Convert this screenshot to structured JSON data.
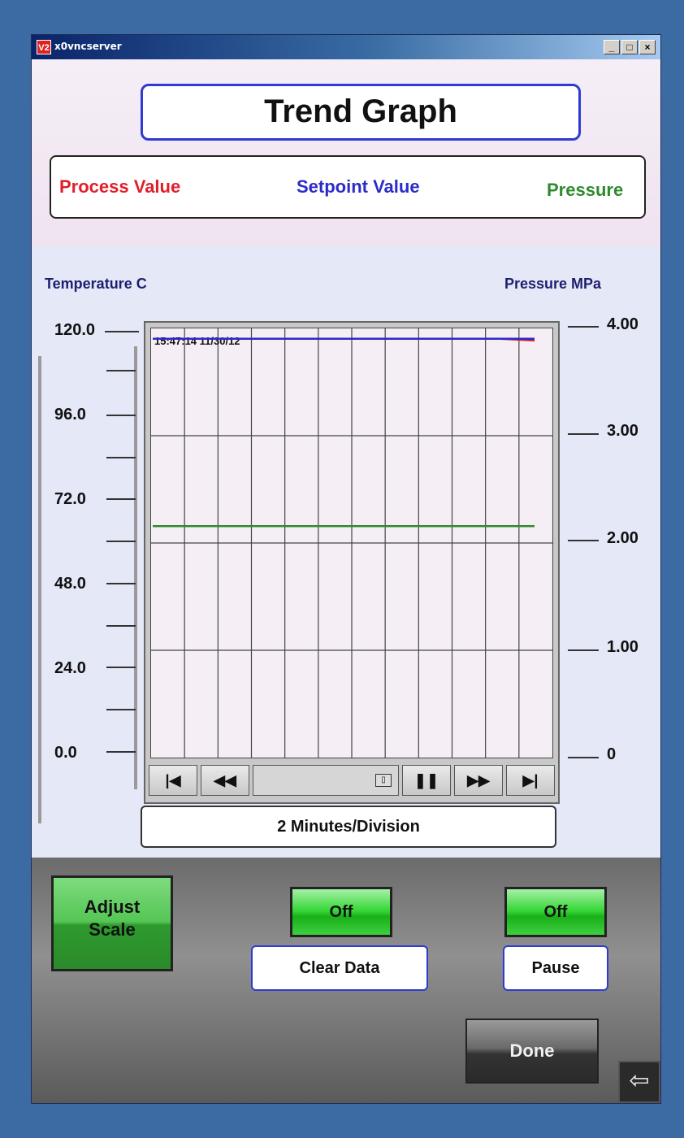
{
  "window": {
    "app_icon": "V2",
    "title": "x0vncserver",
    "controls": [
      "_",
      "□",
      "×"
    ]
  },
  "header": {
    "title": "Trend Graph"
  },
  "legend": {
    "process": "Process Value",
    "setpoint": "Setpoint Value",
    "pressure": "Pressure"
  },
  "axes": {
    "left_title": "Temperature  C",
    "right_title": "Pressure  MPa",
    "left_ticks": [
      "120.0",
      "96.0",
      "72.0",
      "48.0",
      "24.0",
      "0.0"
    ],
    "right_ticks": [
      "4.00",
      "3.00",
      "2.00",
      "1.00",
      "0"
    ]
  },
  "plot": {
    "timestamp": "15:47:14  11/30/12"
  },
  "nav": {
    "first_icon": "first-page-icon",
    "rewind_icon": "rewind-icon",
    "pause_icon": "pause-icon",
    "forward_icon": "fast-forward-icon",
    "last_icon": "last-page-icon"
  },
  "division": "2 Minutes/Division",
  "controls": {
    "adjust_line1": "Adjust",
    "adjust_line2": "Scale",
    "clear_state": "Off",
    "clear_label": "Clear Data",
    "pause_state": "Off",
    "pause_label": "Pause",
    "done": "Done",
    "back_icon": "back-arrow-icon"
  },
  "chart_data": {
    "type": "line",
    "title": "Trend Graph",
    "ylabel": "Temperature  C",
    "y2label": "Pressure  MPa",
    "ylim": [
      0,
      120
    ],
    "y2lim": [
      0,
      4
    ],
    "yticks": [
      0,
      24,
      48,
      72,
      96,
      120
    ],
    "y2ticks": [
      0,
      1,
      2,
      3,
      4
    ],
    "x_divisions": 12,
    "x_unit": "2 Minutes/Division",
    "series": [
      {
        "name": "Process Value",
        "axis": "left",
        "color": "#e01f2a",
        "values": [
          117,
          117,
          117,
          117,
          117,
          117,
          117,
          117,
          117,
          117,
          117,
          116.5
        ]
      },
      {
        "name": "Setpoint Value",
        "axis": "left",
        "color": "#2b2bc8",
        "values": [
          117,
          117,
          117,
          117,
          117,
          117,
          117,
          117,
          117,
          117,
          117,
          117
        ]
      },
      {
        "name": "Pressure",
        "axis": "right",
        "color": "#2e8a2e",
        "values": [
          2.05,
          2.05,
          2.05,
          2.05,
          2.05,
          2.05,
          2.05,
          2.05,
          2.05,
          2.05,
          2.05,
          2.05
        ]
      }
    ]
  }
}
